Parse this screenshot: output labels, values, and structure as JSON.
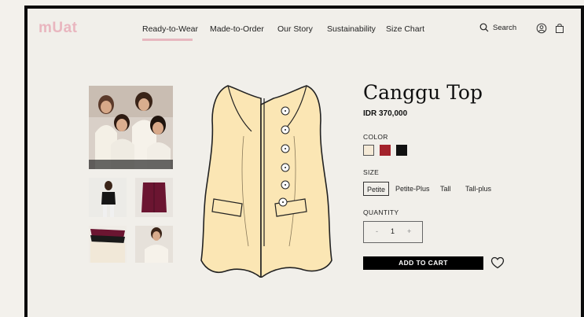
{
  "brand": {
    "logo": "mUat"
  },
  "nav": {
    "items": [
      {
        "label": "Ready-to-Wear"
      },
      {
        "label": "Made-to-Order"
      },
      {
        "label": "Our Story"
      },
      {
        "label": "Sustainability"
      },
      {
        "label": "Size Chart"
      }
    ],
    "search_label": "Search"
  },
  "product": {
    "title": "Canggu Top",
    "price": "IDR 370,000",
    "color_label": "COLOR",
    "colors": [
      "#f5ead7",
      "#a3222b",
      "#111111"
    ],
    "size_label": "SIZE",
    "sizes": [
      "Petite",
      "Petite-Plus",
      "Tall",
      "Tall-plus"
    ],
    "selected_size": "Petite",
    "quantity_label": "QUANTITY",
    "quantity": "1",
    "minus": "-",
    "plus": "+",
    "add_to_cart": "ADD TO CART"
  },
  "colors": {
    "accent": "#e9b6bf",
    "vest_fill": "#fbe6b4",
    "background": "#f1efea"
  },
  "icons": [
    "search-icon",
    "account-icon",
    "bag-icon",
    "heart-icon"
  ]
}
